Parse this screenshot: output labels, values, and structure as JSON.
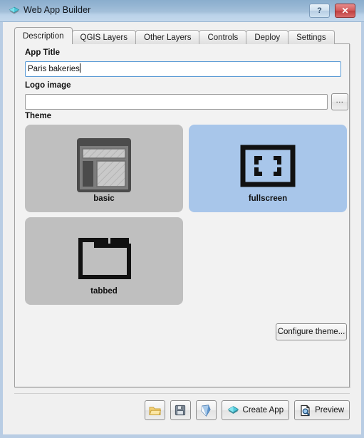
{
  "window": {
    "title": "Web App Builder",
    "icon": "layers-diamond-icon",
    "help_label": "?",
    "close_label": "✕",
    "frame_color": "#b9cde4",
    "titlebar_gradient_top": "#8aadcd",
    "titlebar_gradient_bottom": "#c3d8ec"
  },
  "tabs": [
    {
      "label": "Description",
      "active": true
    },
    {
      "label": "QGIS Layers",
      "active": false
    },
    {
      "label": "Other Layers",
      "active": false
    },
    {
      "label": "Controls",
      "active": false
    },
    {
      "label": "Deploy",
      "active": false
    },
    {
      "label": "Settings",
      "active": false
    }
  ],
  "form": {
    "app_title": {
      "label": "App Title",
      "value": "Paris bakeries",
      "placeholder": "",
      "focused": true
    },
    "logo_image": {
      "label": "Logo image",
      "value": "",
      "placeholder": "",
      "browse_label": "..."
    }
  },
  "theme": {
    "label": "Theme",
    "selected": "fullscreen",
    "selected_color": "#a8c6ea",
    "card_color": "#bfbfbf",
    "options": [
      {
        "name": "basic",
        "icon": "layout-basic-icon",
        "selected": false
      },
      {
        "name": "fullscreen",
        "icon": "layout-fullscreen-icon",
        "selected": true
      },
      {
        "name": "tabbed",
        "icon": "layout-tabbed-icon",
        "selected": false
      }
    ],
    "configure_label": "Configure theme..."
  },
  "footer": {
    "buttons": [
      {
        "label": "",
        "icon": "open-folder-icon",
        "icon_only": true
      },
      {
        "label": "",
        "icon": "save-floppy-icon",
        "icon_only": true
      },
      {
        "label": "",
        "icon": "qgis-gem-icon",
        "icon_only": true
      },
      {
        "label": "Create App",
        "icon": "layers-diamond-icon",
        "icon_only": false
      },
      {
        "label": "Preview",
        "icon": "document-search-icon",
        "icon_only": false
      }
    ]
  }
}
